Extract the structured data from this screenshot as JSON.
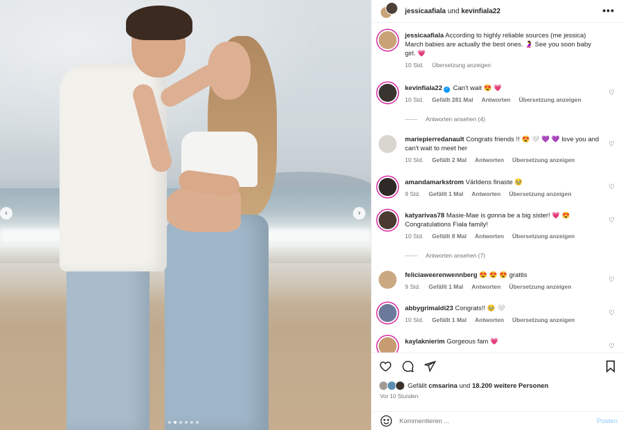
{
  "photo": {
    "alt_dots": 6,
    "active_dot": 1,
    "prev_icon": "chevron-left-icon",
    "next_icon": "chevron-right-icon"
  },
  "header": {
    "user1": "jessicaafiala",
    "und": "und",
    "user2": "kevinfiala22",
    "more_icon": "more-horizontal-icon",
    "more_label": "•••"
  },
  "caption": {
    "user": "jessicaafiala",
    "text": "According to highly reliable sources (me jessica) March babies are actually the best ones. 🤰 See you soon baby girl. 💗",
    "time": "10 Std.",
    "translate": "Übersetzung anzeigen"
  },
  "comments": [
    {
      "user": "kevinfiala22",
      "verified": true,
      "text": "Can't wait 😍 💗",
      "time": "10 Std.",
      "likes": "Gefällt 281 Mal",
      "reply": "Antworten",
      "translate": "Übersetzung anzeigen",
      "view_replies": "Antworten ansehen (4)",
      "avatar_color": "#3a3430"
    },
    {
      "user": "mariepierredanault",
      "text": "Congrats friends !! 😍 🤍 💜 💜 love you and can't wait to meet her",
      "time": "10 Std.",
      "likes": "Gefällt 2 Mal",
      "reply": "Antworten",
      "translate": "Übersetzung anzeigen",
      "avatar_color": "#d9d5cf"
    },
    {
      "user": "amandamarkstrom",
      "text": "Världens finaste 🥹",
      "time": "9 Std.",
      "likes": "Gefällt 1 Mal",
      "reply": "Antworten",
      "translate": "Übersetzung anzeigen",
      "avatar_color": "#2f2a28"
    },
    {
      "user": "katyarivas78",
      "text": "Masie-Mae is gonna be a big sister! 💗 😍 Congratulations Fiala family!",
      "time": "10 Std.",
      "likes": "Gefällt 8 Mal",
      "reply": "Antworten",
      "translate": "Übersetzung anzeigen",
      "view_replies": "Antworten ansehen (7)",
      "avatar_color": "#4b3a32"
    },
    {
      "user": "feliciaweerenwennberg",
      "text": "😍 😍 😍 grattis",
      "time": "9 Std.",
      "likes": "Gefällt 1 Mal",
      "reply": "Antworten",
      "translate": "Übersetzung anzeigen",
      "avatar_color": "#c9a882"
    },
    {
      "user": "abbygrimaldi23",
      "text": "Congrats!! 🥹 🤍",
      "time": "10 Std.",
      "likes": "Gefällt 1 Mal",
      "reply": "Antworten",
      "translate": "Übersetzung anzeigen",
      "avatar_color": "#6b7a9a"
    },
    {
      "user": "kaylaknierim",
      "text": "Gorgeous fam 💗",
      "avatar_color": "#c89c72"
    }
  ],
  "actions": {
    "like_icon": "heart-icon",
    "comment_icon": "comment-icon",
    "share_icon": "send-icon",
    "save_icon": "bookmark-icon"
  },
  "likes": {
    "prefix": "Gefällt",
    "user": "cmsarina",
    "und": "und",
    "others": "18.200 weitere Personen"
  },
  "time_ago": "Vor 10 Stunden",
  "compose": {
    "emoji_icon": "emoji-icon",
    "placeholder": "Kommentieren ...",
    "post": "Posten"
  },
  "colors": {
    "link_blue": "#0095f6",
    "post_disabled": "#8fc7fb",
    "muted": "#737373",
    "story_ring": "#d6249f"
  }
}
